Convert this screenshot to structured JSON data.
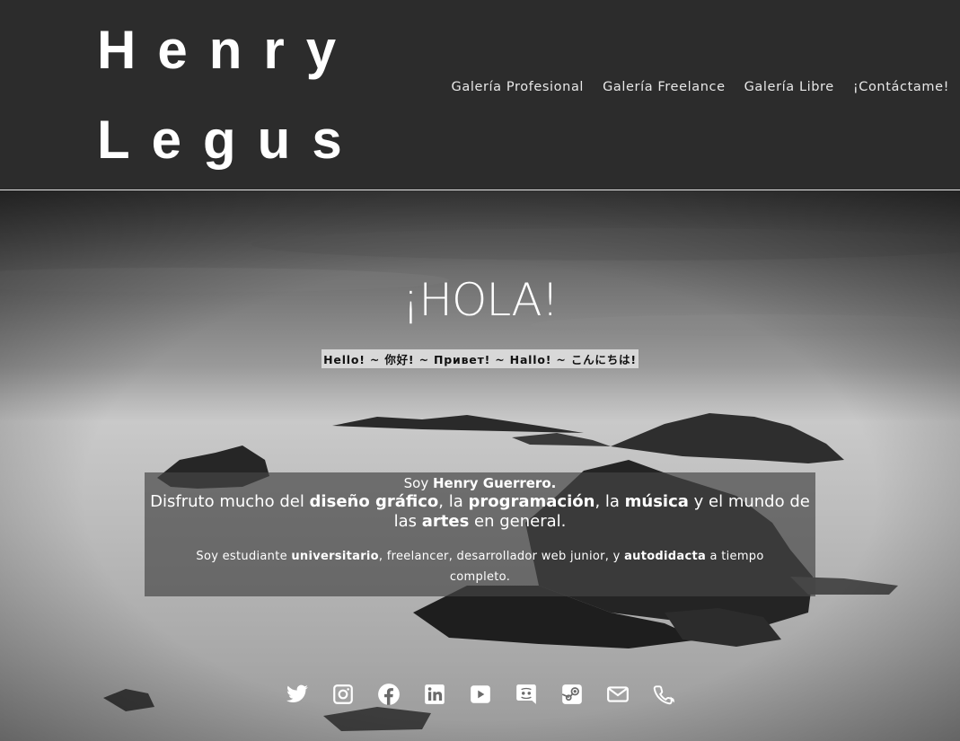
{
  "header": {
    "logo_line1": "Henry",
    "logo_line2": "Legus",
    "nav": [
      {
        "label": "Galería Profesional"
      },
      {
        "label": "Galería Freelance"
      },
      {
        "label": "Galería Libre"
      },
      {
        "label": "¡Contáctame!"
      }
    ]
  },
  "hero": {
    "title": "¡HOLA!",
    "greetings": "Hello! ~ 你好! ~ Привет! ~ Hallo! ~ こんにちは!",
    "bio": {
      "l1_a": "Soy ",
      "l1_b": "Henry Guerrero.",
      "l2_a": "Disfruto mucho del ",
      "l2_b": "diseño gráfico",
      "l2_c": ", la ",
      "l2_d": "programación",
      "l2_e": ", la ",
      "l2_f": "música",
      "l2_g": " y el mundo de las ",
      "l2_h": "artes",
      "l2_i": " en general.",
      "l3_a": "Soy estudiante ",
      "l3_b": "universitario",
      "l3_c": ", freelancer, desarrollador web junior, y ",
      "l3_d": "autodidacta",
      "l3_e": " a tiempo completo."
    }
  },
  "social_icons": [
    "twitter-icon",
    "instagram-icon",
    "facebook-icon",
    "linkedin-icon",
    "youtube-icon",
    "discord-icon",
    "steam-icon",
    "mail-icon",
    "phone-icon"
  ],
  "colors": {
    "header_bg": "#2c2c2c",
    "text": "#ffffff"
  }
}
